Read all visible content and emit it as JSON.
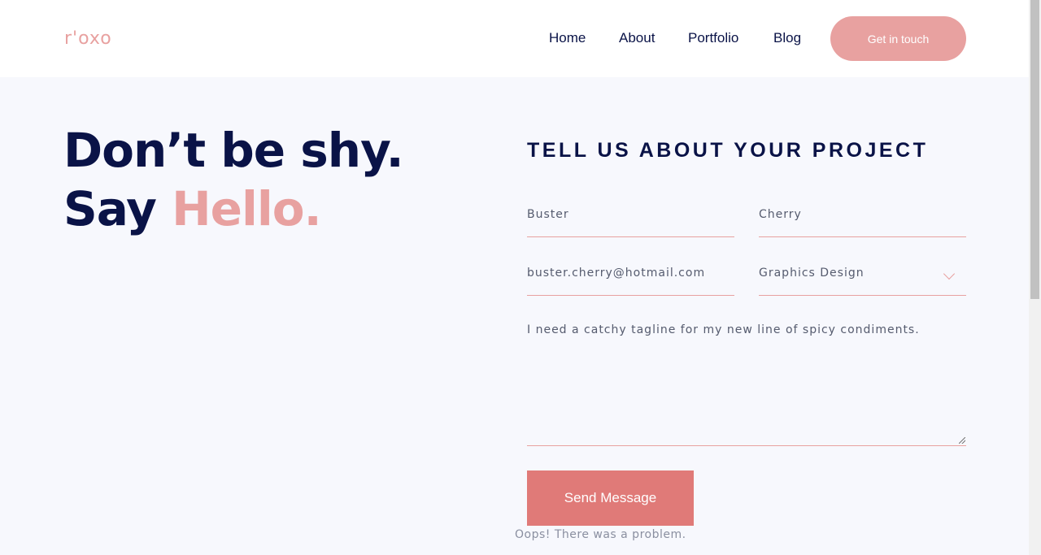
{
  "header": {
    "logo": "r'oxo",
    "nav": [
      "Home",
      "About",
      "Portfolio",
      "Blog"
    ],
    "cta": "Get in touch"
  },
  "hero": {
    "line1": "Don’t be shy.",
    "line2_prefix": "Say ",
    "line2_accent": "Hello."
  },
  "form": {
    "title": "TELL US ABOUT YOUR PROJECT",
    "first_name": "Buster",
    "last_name": "Cherry",
    "email": "buster.cherry@hotmail.com",
    "service": "Graphics Design",
    "message": "I need a catchy tagline for my new line of spicy condiments.",
    "submit": "Send Message",
    "error": "Oops! There was a problem."
  },
  "colors": {
    "navy": "#0a1347",
    "accent": "#e8a1a0",
    "button": "#e07a78",
    "background": "#f7f8fd"
  }
}
